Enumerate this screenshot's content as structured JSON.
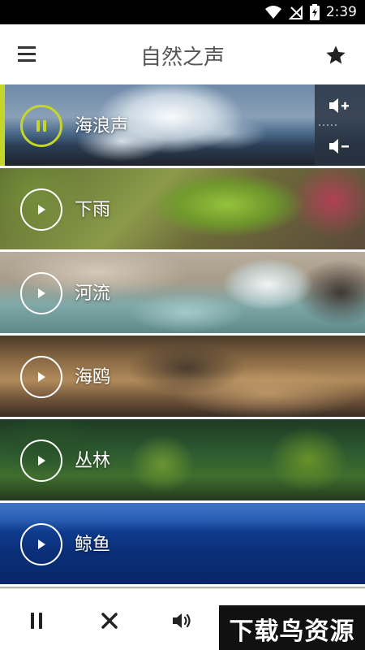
{
  "status_bar": {
    "time": "2:39",
    "icons": [
      "wifi-icon",
      "signal-no-sim-icon",
      "battery-charging-icon"
    ]
  },
  "app_bar": {
    "title": "自然之声",
    "left_icon": "menu-icon",
    "right_icon": "star-icon"
  },
  "sounds": [
    {
      "label": "海浪声",
      "state": "playing",
      "icon": "pause-icon"
    },
    {
      "label": "下雨",
      "state": "stopped",
      "icon": "play-icon"
    },
    {
      "label": "河流",
      "state": "stopped",
      "icon": "play-icon"
    },
    {
      "label": "海鸥",
      "state": "stopped",
      "icon": "play-icon"
    },
    {
      "label": "丛林",
      "state": "stopped",
      "icon": "play-icon"
    },
    {
      "label": "鲸鱼",
      "state": "stopped",
      "icon": "play-icon"
    }
  ],
  "volume_panel": {
    "icons": [
      "volume-up-icon",
      "volume-down-icon"
    ]
  },
  "bottom_bar": {
    "icons": [
      "pause-all-icon",
      "close-icon",
      "volume-icon"
    ]
  },
  "watermark": {
    "text": "下载鸟资源"
  },
  "colors": {
    "accent": "#c5d62b",
    "status_bar": "#000000",
    "title_text": "#555555"
  }
}
